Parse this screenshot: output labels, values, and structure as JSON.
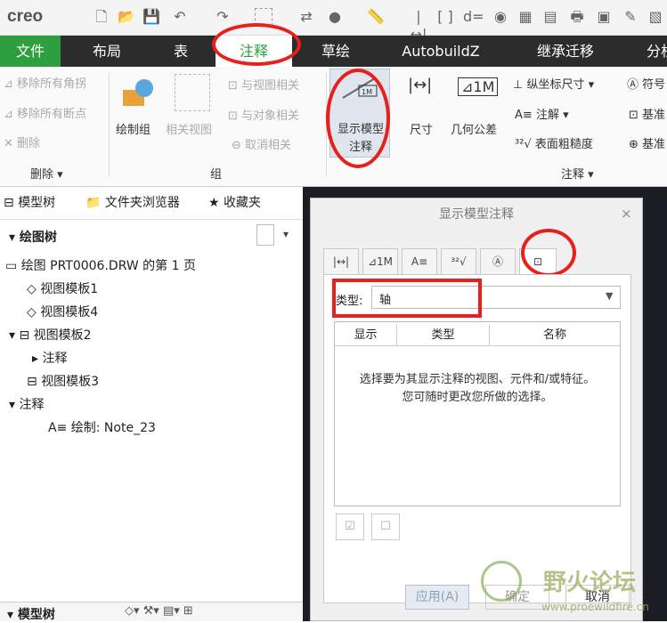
{
  "app": {
    "logo": "creo"
  },
  "tabs": [
    "文件",
    "布局",
    "表",
    "注释",
    "草绘",
    "AutobuildZ",
    "继承迁移",
    "分析"
  ],
  "ribbon": {
    "delete_group": {
      "items": [
        "移除所有角拐",
        "移除所有断点",
        "删除"
      ],
      "label": "删除 ▾"
    },
    "group_group": {
      "draw_group": "绘制组",
      "related_view": "相关视图",
      "with_view": "与视图相关",
      "with_object": "与对象相关",
      "cancel_related": "取消相关",
      "label": "组"
    },
    "annotation_group": {
      "show_model": "显示模型注释",
      "dimension": "尺寸",
      "gtol": "几何公差",
      "ordinate": "纵坐标尺寸 ▾",
      "note": "注解 ▾",
      "surface_finish": "表面粗糙度",
      "symbol": "符号",
      "datum1": "基准",
      "datum2": "基准",
      "label": "注释 ▾"
    }
  },
  "left_panel": {
    "tabs": [
      "模型树",
      "文件夹浏览器",
      "收藏夹"
    ],
    "tree_title": "绘图树",
    "tree_items": [
      "绘图 PRT0006.DRW 的第 1 页",
      "视图模板1",
      "视图模板4",
      "视图模板2",
      "注释",
      "视图模板3",
      "注释",
      "绘制: Note_23"
    ],
    "bottom_title": "模型树"
  },
  "dialog": {
    "title": "显示模型注释",
    "close": "×",
    "tabs": [
      "|↔|",
      "⊿1M",
      "A≡",
      "³²√",
      "Ⓐ",
      "⊡"
    ],
    "type_label": "类型:",
    "type_value": "轴",
    "columns": [
      "显示",
      "类型",
      "名称"
    ],
    "message_line1": "选择要为其显示注释的视图、元件和/或特征。",
    "message_line2": "您可随时更改您所做的选择。",
    "apply": "应用(A)",
    "ok": "确定",
    "cancel": "取消"
  },
  "watermark": {
    "text": "野火论坛",
    "url": "www.proewildfire.cn"
  }
}
